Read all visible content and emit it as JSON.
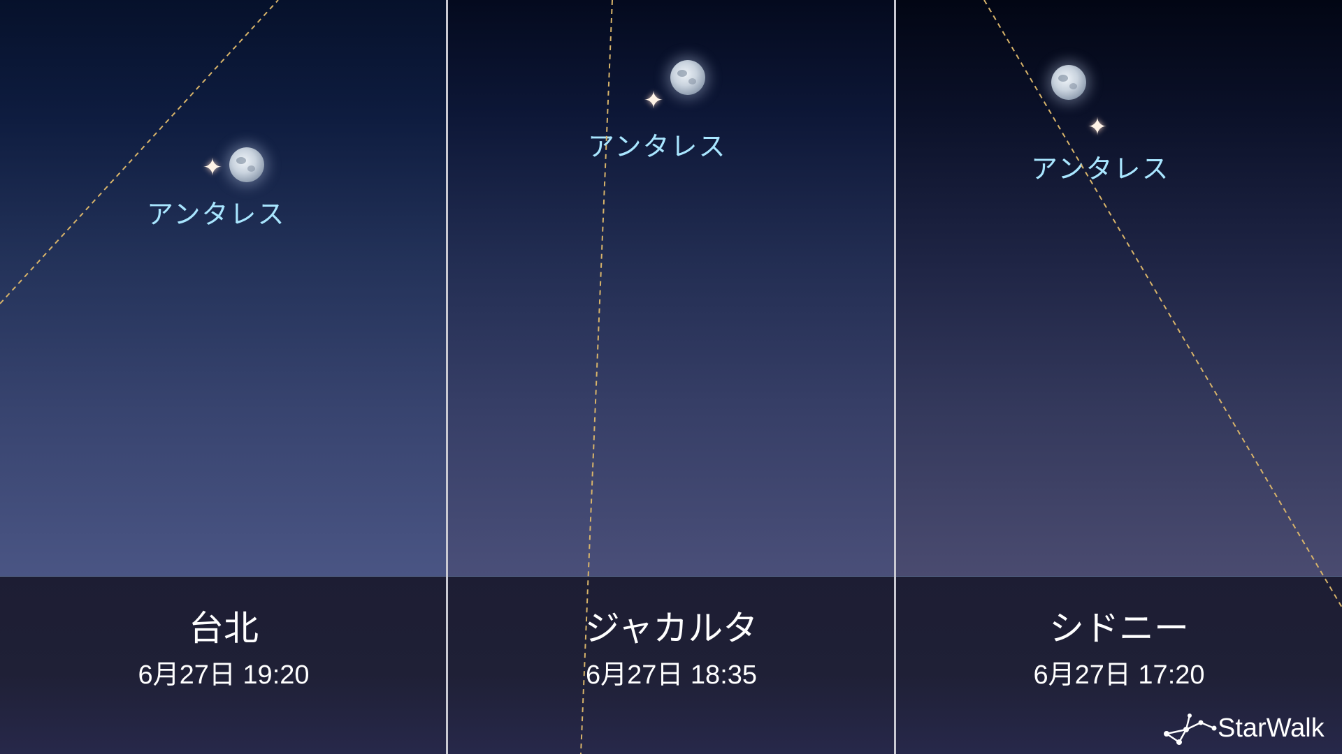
{
  "star_label": "アンタレス",
  "panels": [
    {
      "city": "台北",
      "datetime": "6月27日 19:20"
    },
    {
      "city": "ジャカルタ",
      "datetime": "6月27日 18:35"
    },
    {
      "city": "シドニー",
      "datetime": "6月27日 17:20"
    }
  ],
  "brand": {
    "name": "StarWalk"
  },
  "icons": {
    "moon": "moon-icon",
    "star": "four-point-star-icon",
    "logo": "constellation-logo-icon"
  },
  "colors": {
    "ecliptic_line": "#d8b46a",
    "star_label": "#a9e6ff",
    "divider": "#c9c9d2"
  }
}
